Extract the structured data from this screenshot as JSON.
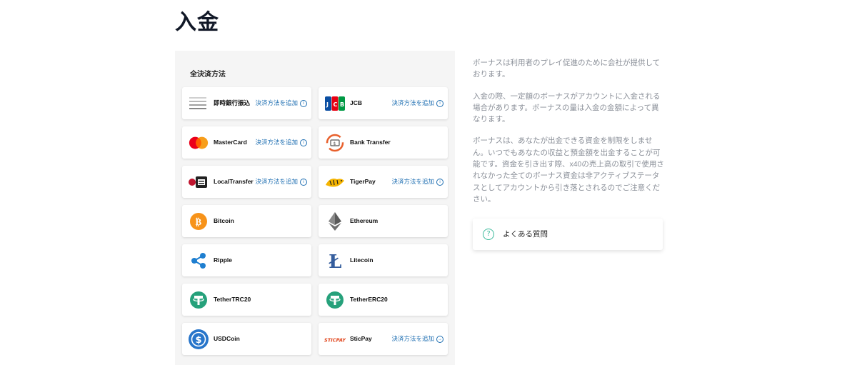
{
  "page": {
    "title": "入金"
  },
  "methods_section": {
    "heading": "全決済方法",
    "add_label": "決済方法を追加",
    "methods": [
      {
        "name": "即時銀行振込",
        "icon": "instant-bank-icon",
        "add": true,
        "add_icon": "info"
      },
      {
        "name": "JCB",
        "icon": "jcb-icon",
        "add": true,
        "add_icon": "info"
      },
      {
        "name": "MasterCard",
        "icon": "mastercard-icon",
        "add": true,
        "add_icon": "info"
      },
      {
        "name": "Bank Transfer",
        "icon": "bank-transfer-icon",
        "add": false
      },
      {
        "name": "LocalTransfer",
        "icon": "local-transfer-icon",
        "add": true,
        "add_icon": "info"
      },
      {
        "name": "TigerPay",
        "icon": "tigerpay-icon",
        "add": true,
        "add_icon": "info"
      },
      {
        "name": "Bitcoin",
        "icon": "bitcoin-icon",
        "add": false
      },
      {
        "name": "Ethereum",
        "icon": "ethereum-icon",
        "add": false
      },
      {
        "name": "Ripple",
        "icon": "ripple-icon",
        "add": false
      },
      {
        "name": "Litecoin",
        "icon": "litecoin-icon",
        "add": false
      },
      {
        "name": "TetherTRC20",
        "icon": "tether-icon",
        "add": false
      },
      {
        "name": "TetherERC20",
        "icon": "tether-icon",
        "add": false
      },
      {
        "name": "USDCoin",
        "icon": "usdcoin-icon",
        "add": false
      },
      {
        "name": "SticPay",
        "icon": "sticpay-icon",
        "add": true,
        "add_icon": "arrow"
      }
    ]
  },
  "sidebar": {
    "notes": [
      "ボーナスは利用者のプレイ促進のために会社が提供しております。",
      "入金の際、一定額のボーナスがアカウントに入金される場合があります。ボーナスの量は入金の金額によって異なります。",
      "ボーナスは、あなたが出金できる資金を制限をしません。いつでもあなたの収益と預金額を出金することが可能です。資金を引き出す際、x40の売上高の取引で使用されなかった全てのボーナス資金は非アクティブステータスとしてアカウントから引き落とされるのでご注意ください。"
    ],
    "faq_label": "よくある質問"
  },
  "colors": {
    "accent_blue": "#1f6fb2",
    "faq_green": "#3cb99b",
    "panel_bg": "#f5f5f5",
    "bitcoin": "#f7931a",
    "tether": "#26a17b",
    "usdc": "#2775ca",
    "ripple": "#23292f"
  }
}
